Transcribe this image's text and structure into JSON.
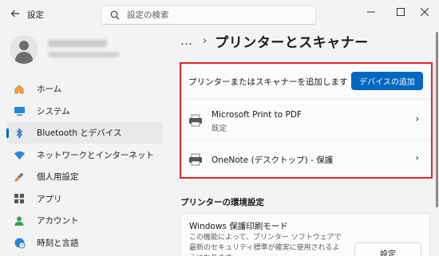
{
  "window": {
    "title": "設定",
    "search_placeholder": "設定の検索"
  },
  "sidebar": {
    "items": [
      {
        "label": "ホーム",
        "icon": "home-icon"
      },
      {
        "label": "システム",
        "icon": "system-icon"
      },
      {
        "label": "Bluetooth とデバイス",
        "icon": "bluetooth-icon",
        "active": true
      },
      {
        "label": "ネットワークとインターネット",
        "icon": "wifi-icon"
      },
      {
        "label": "個人用設定",
        "icon": "brush-icon"
      },
      {
        "label": "アプリ",
        "icon": "apps-icon"
      },
      {
        "label": "アカウント",
        "icon": "account-icon"
      },
      {
        "label": "時刻と言語",
        "icon": "globe-clock-icon"
      }
    ]
  },
  "breadcrumb": {
    "dots": "…",
    "title": "プリンターとスキャナー"
  },
  "add_device": {
    "label": "プリンターまたはスキャナーを追加します",
    "button": "デバイスの追加"
  },
  "printers": [
    {
      "name": "Microsoft Print to PDF",
      "status": "既定"
    },
    {
      "name": "OneNote (デスクトップ) - 保護",
      "status": ""
    }
  ],
  "preferences": {
    "section_title": "プリンターの環境設定",
    "card_title": "Windows 保護印刷モード",
    "card_desc": "この機能によって、プリンター ソフトウェアで最新のセキュリティ標準が確実に使用されるようになります。",
    "button": "設定"
  },
  "colors": {
    "accent": "#0067c0",
    "highlight_border": "#e0262b"
  }
}
